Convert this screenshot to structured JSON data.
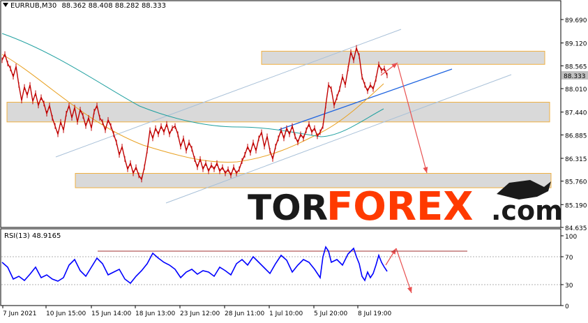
{
  "header": {
    "symbol_timeframe": "EURRUB,M30",
    "ohlc": "88.362 88.408 88.282 88.333"
  },
  "rsi_header": {
    "label": "RSI(13) 48.9165"
  },
  "watermark": {
    "part1": "TOR",
    "part2": "FOREX",
    "part3": ".com"
  },
  "colors": {
    "candle": "#c00000",
    "ma_fast": "#e8a020",
    "ma_slow": "#20a0a0",
    "channel": "#a8c0d8",
    "trend": "#1e64e0",
    "arrow": "#e85050",
    "rsi": "#0000ff",
    "zone_fill": "#d9d9d9",
    "zone_border": "#f0b040"
  },
  "chart_data": [
    {
      "type": "line",
      "title": "EURRUB,M30",
      "y_ticks": [
        "89.690",
        "89.120",
        "88.565",
        "88.010",
        "87.440",
        "86.885",
        "86.315",
        "85.760",
        "85.190",
        "84.635"
      ],
      "x_ticks": [
        "7 Jun 2021",
        "10 Jun 15:00",
        "15 Jun 14:00",
        "18 Jun 13:00",
        "23 Jun 12:00",
        "28 Jun 11:00",
        "1 Jul 10:00",
        "5 Jul 20:00",
        "8 Jul 19:00"
      ],
      "ylim": [
        84.635,
        89.69
      ],
      "current_price": "88.333",
      "price_path": [
        [
          0,
          88.7
        ],
        [
          4,
          88.85
        ],
        [
          8,
          88.62
        ],
        [
          12,
          88.5
        ],
        [
          16,
          88.3
        ],
        [
          20,
          88.55
        ],
        [
          24,
          88.1
        ],
        [
          28,
          87.72
        ],
        [
          32,
          88.05
        ],
        [
          36,
          87.85
        ],
        [
          40,
          88.1
        ],
        [
          44,
          87.7
        ],
        [
          48,
          87.9
        ],
        [
          52,
          87.6
        ],
        [
          56,
          87.8
        ],
        [
          60,
          87.65
        ],
        [
          64,
          87.4
        ],
        [
          68,
          87.6
        ],
        [
          72,
          87.3
        ],
        [
          76,
          87.1
        ],
        [
          80,
          86.9
        ],
        [
          84,
          87.2
        ],
        [
          88,
          87.0
        ],
        [
          92,
          87.4
        ],
        [
          96,
          87.6
        ],
        [
          100,
          87.3
        ],
        [
          104,
          87.55
        ],
        [
          108,
          87.2
        ],
        [
          112,
          87.5
        ],
        [
          116,
          87.35
        ],
        [
          120,
          87.1
        ],
        [
          124,
          87.3
        ],
        [
          128,
          87.05
        ],
        [
          132,
          87.45
        ],
        [
          136,
          87.6
        ],
        [
          140,
          87.3
        ],
        [
          144,
          87.2
        ],
        [
          148,
          87.0
        ],
        [
          152,
          87.25
        ],
        [
          156,
          87.1
        ],
        [
          160,
          86.9
        ],
        [
          164,
          86.7
        ],
        [
          168,
          86.4
        ],
        [
          172,
          86.6
        ],
        [
          176,
          86.3
        ],
        [
          180,
          86.05
        ],
        [
          184,
          86.2
        ],
        [
          188,
          85.95
        ],
        [
          192,
          86.1
        ],
        [
          196,
          85.9
        ],
        [
          200,
          85.8
        ],
        [
          204,
          86.1
        ],
        [
          208,
          86.5
        ],
        [
          212,
          87.0
        ],
        [
          216,
          86.8
        ],
        [
          220,
          87.05
        ],
        [
          224,
          86.9
        ],
        [
          228,
          87.1
        ],
        [
          232,
          86.95
        ],
        [
          236,
          87.15
        ],
        [
          240,
          86.9
        ],
        [
          244,
          87.05
        ],
        [
          248,
          87.1
        ],
        [
          252,
          86.9
        ],
        [
          256,
          86.6
        ],
        [
          260,
          86.8
        ],
        [
          264,
          86.5
        ],
        [
          268,
          86.7
        ],
        [
          272,
          86.55
        ],
        [
          276,
          86.3
        ],
        [
          280,
          86.1
        ],
        [
          284,
          86.3
        ],
        [
          288,
          86.05
        ],
        [
          292,
          86.2
        ],
        [
          296,
          86.0
        ],
        [
          300,
          86.15
        ],
        [
          304,
          86.05
        ],
        [
          308,
          86.2
        ],
        [
          312,
          86.0
        ],
        [
          316,
          86.1
        ],
        [
          320,
          85.95
        ],
        [
          324,
          86.05
        ],
        [
          328,
          85.9
        ],
        [
          332,
          86.1
        ],
        [
          336,
          85.95
        ],
        [
          340,
          86.05
        ],
        [
          344,
          86.25
        ],
        [
          348,
          86.4
        ],
        [
          352,
          86.6
        ],
        [
          356,
          86.45
        ],
        [
          360,
          86.7
        ],
        [
          364,
          86.5
        ],
        [
          368,
          86.8
        ],
        [
          372,
          86.95
        ],
        [
          376,
          86.6
        ],
        [
          380,
          86.85
        ],
        [
          384,
          86.5
        ],
        [
          388,
          86.3
        ],
        [
          392,
          86.6
        ],
        [
          396,
          86.8
        ],
        [
          400,
          87.0
        ],
        [
          404,
          86.8
        ],
        [
          408,
          87.05
        ],
        [
          412,
          86.9
        ],
        [
          416,
          87.1
        ],
        [
          420,
          86.85
        ],
        [
          424,
          86.7
        ],
        [
          428,
          86.9
        ],
        [
          432,
          86.8
        ],
        [
          436,
          87.0
        ],
        [
          440,
          87.15
        ],
        [
          444,
          86.95
        ],
        [
          448,
          87.05
        ],
        [
          452,
          86.85
        ],
        [
          456,
          86.95
        ],
        [
          460,
          87.1
        ],
        [
          464,
          87.6
        ],
        [
          468,
          88.1
        ],
        [
          472,
          88.0
        ],
        [
          476,
          87.6
        ],
        [
          480,
          87.8
        ],
        [
          484,
          88.0
        ],
        [
          488,
          88.3
        ],
        [
          492,
          88.1
        ],
        [
          496,
          88.5
        ],
        [
          500,
          88.9
        ],
        [
          504,
          88.7
        ],
        [
          508,
          89.0
        ],
        [
          512,
          88.8
        ],
        [
          516,
          88.3
        ],
        [
          520,
          88.1
        ],
        [
          524,
          87.95
        ],
        [
          528,
          88.1
        ],
        [
          532,
          88.0
        ],
        [
          536,
          88.25
        ],
        [
          540,
          88.6
        ],
        [
          544,
          88.45
        ],
        [
          548,
          88.5
        ],
        [
          552,
          88.33
        ]
      ],
      "support_resistance_zones": [
        {
          "low": 88.6,
          "high": 88.92
        },
        {
          "low": 87.2,
          "high": 87.68
        },
        {
          "low": 85.6,
          "high": 85.95
        }
      ]
    },
    {
      "type": "line",
      "title": "RSI(13) 48.9165",
      "y_ticks": [
        "100",
        "70",
        "30",
        "0"
      ],
      "ylim": [
        0,
        100
      ],
      "level_line": 78,
      "rsi_path": [
        [
          0,
          62
        ],
        [
          8,
          55
        ],
        [
          16,
          38
        ],
        [
          24,
          42
        ],
        [
          32,
          36
        ],
        [
          40,
          45
        ],
        [
          48,
          55
        ],
        [
          56,
          40
        ],
        [
          64,
          44
        ],
        [
          72,
          38
        ],
        [
          80,
          35
        ],
        [
          88,
          40
        ],
        [
          96,
          58
        ],
        [
          104,
          66
        ],
        [
          112,
          50
        ],
        [
          120,
          42
        ],
        [
          128,
          55
        ],
        [
          136,
          68
        ],
        [
          144,
          60
        ],
        [
          152,
          44
        ],
        [
          160,
          48
        ],
        [
          168,
          52
        ],
        [
          176,
          38
        ],
        [
          184,
          32
        ],
        [
          192,
          42
        ],
        [
          200,
          50
        ],
        [
          208,
          60
        ],
        [
          216,
          75
        ],
        [
          224,
          68
        ],
        [
          232,
          62
        ],
        [
          240,
          58
        ],
        [
          248,
          52
        ],
        [
          256,
          40
        ],
        [
          264,
          48
        ],
        [
          272,
          52
        ],
        [
          280,
          45
        ],
        [
          288,
          50
        ],
        [
          296,
          48
        ],
        [
          304,
          42
        ],
        [
          312,
          55
        ],
        [
          320,
          50
        ],
        [
          328,
          44
        ],
        [
          336,
          60
        ],
        [
          344,
          66
        ],
        [
          352,
          58
        ],
        [
          360,
          70
        ],
        [
          368,
          62
        ],
        [
          376,
          54
        ],
        [
          384,
          46
        ],
        [
          392,
          60
        ],
        [
          400,
          72
        ],
        [
          408,
          65
        ],
        [
          416,
          48
        ],
        [
          424,
          58
        ],
        [
          432,
          66
        ],
        [
          440,
          62
        ],
        [
          448,
          52
        ],
        [
          456,
          40
        ],
        [
          460,
          70
        ],
        [
          464,
          84
        ],
        [
          468,
          78
        ],
        [
          472,
          62
        ],
        [
          480,
          66
        ],
        [
          488,
          58
        ],
        [
          496,
          74
        ],
        [
          504,
          82
        ],
        [
          508,
          70
        ],
        [
          512,
          60
        ],
        [
          516,
          42
        ],
        [
          520,
          36
        ],
        [
          524,
          48
        ],
        [
          528,
          40
        ],
        [
          532,
          46
        ],
        [
          536,
          58
        ],
        [
          540,
          72
        ],
        [
          544,
          62
        ],
        [
          548,
          55
        ],
        [
          552,
          49
        ]
      ]
    }
  ]
}
